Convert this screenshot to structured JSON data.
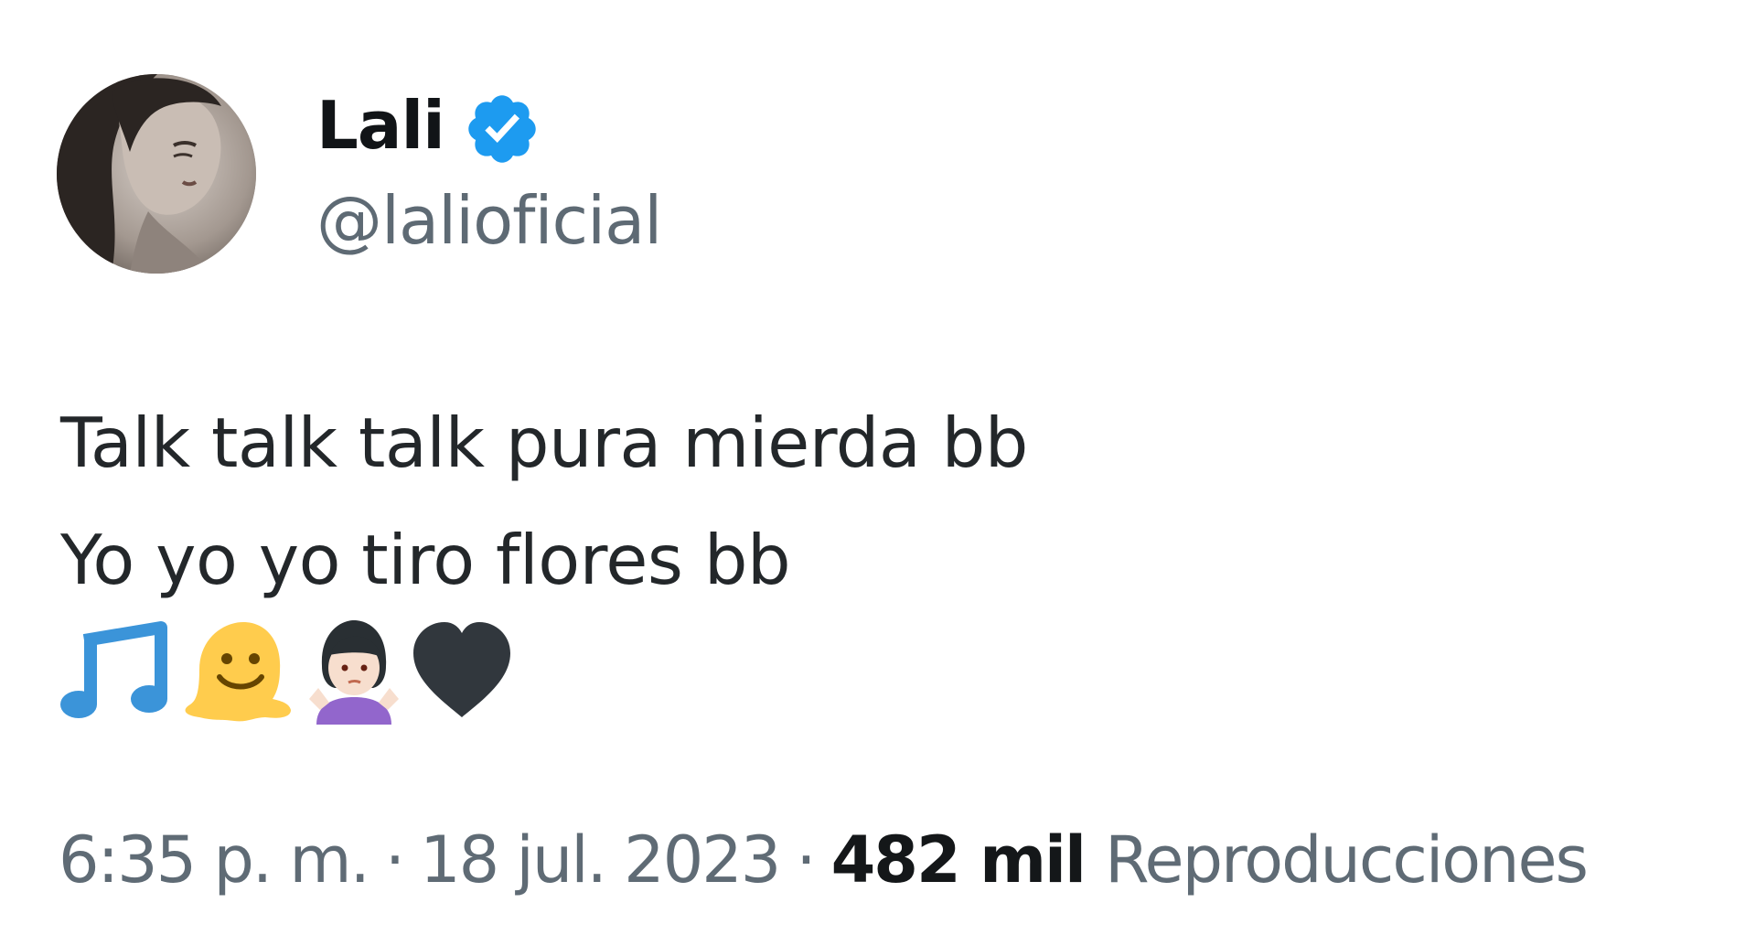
{
  "author": {
    "display_name": "Lali",
    "handle": "@lalioficial",
    "verified": true,
    "avatar_icon": "profile-photo",
    "badge_color": "#1d9bf0"
  },
  "tweet": {
    "lines": [
      "Talk talk talk pura mierda bb",
      "Yo yo yo tiro flores bb"
    ],
    "emoji_icons": [
      "musical-notes-icon",
      "melting-face-icon",
      "person-shrugging-icon",
      "black-heart-icon"
    ]
  },
  "meta": {
    "time": "6:35 p. m.",
    "separator": "·",
    "date": "18 jul. 2023",
    "views_count": "482 mil",
    "views_label": "Reproducciones"
  }
}
